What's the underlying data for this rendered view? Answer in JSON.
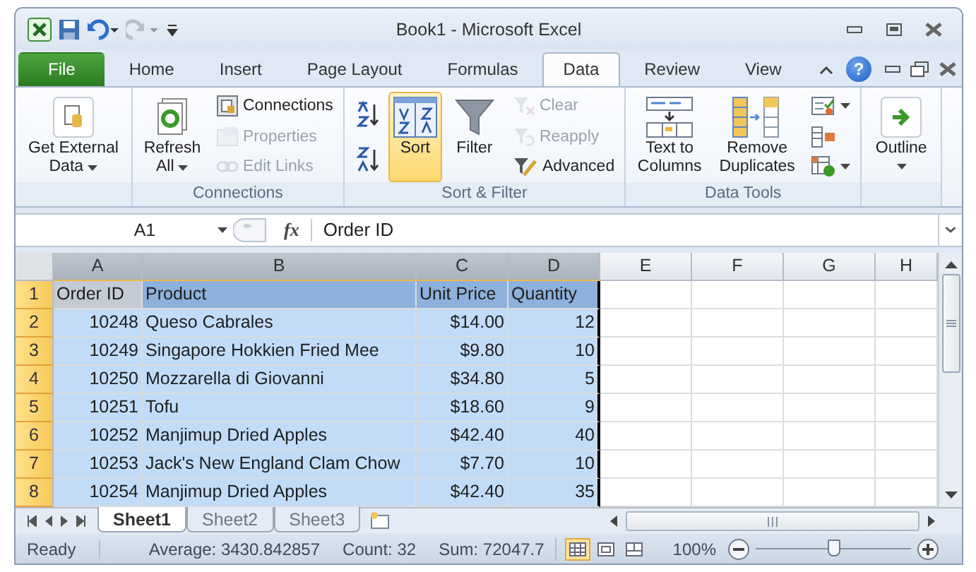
{
  "window": {
    "title": "Book1 - Microsoft Excel"
  },
  "ribbon_tabs": [
    {
      "label": "File",
      "kind": "file",
      "selected": false
    },
    {
      "label": "Home",
      "kind": "tab",
      "selected": false
    },
    {
      "label": "Insert",
      "kind": "tab",
      "selected": false
    },
    {
      "label": "Page Layout",
      "kind": "tab",
      "selected": false
    },
    {
      "label": "Formulas",
      "kind": "tab",
      "selected": false
    },
    {
      "label": "Data",
      "kind": "tab",
      "selected": true
    },
    {
      "label": "Review",
      "kind": "tab",
      "selected": false
    },
    {
      "label": "View",
      "kind": "tab",
      "selected": false
    }
  ],
  "help_button": "?",
  "ribbon_groups": [
    {
      "items": [
        {
          "kind": "large",
          "label": "Get External Data",
          "dropdown": true,
          "disabled": false,
          "highlighted": false
        }
      ]
    },
    {
      "label": "Connections",
      "items": [
        {
          "kind": "large",
          "label": "Refresh All",
          "dropdown": true,
          "disabled": false,
          "highlighted": false
        },
        {
          "kind": "stack",
          "items": [
            {
              "label": "Connections",
              "disabled": false
            },
            {
              "label": "Properties",
              "disabled": true
            },
            {
              "label": "Edit Links",
              "disabled": true
            }
          ]
        }
      ]
    },
    {
      "label": "Sort & Filter",
      "items": [
        {
          "kind": "stack",
          "items": [
            {
              "disabled": false
            },
            {
              "disabled": false
            }
          ]
        },
        {
          "kind": "large",
          "label": "Sort",
          "dropdown": false,
          "disabled": false,
          "highlighted": true
        },
        {
          "kind": "large",
          "label": "Filter",
          "dropdown": false,
          "disabled": false,
          "highlighted": false
        },
        {
          "kind": "stack",
          "items": [
            {
              "label": "Clear",
              "disabled": true
            },
            {
              "label": "Reapply",
              "disabled": true
            },
            {
              "label": "Advanced",
              "disabled": false
            }
          ]
        }
      ]
    },
    {
      "label": "Data Tools",
      "items": [
        {
          "kind": "large",
          "label": "Text to Columns",
          "dropdown": false,
          "disabled": false,
          "highlighted": false
        },
        {
          "kind": "large",
          "label": "Remove Duplicates",
          "dropdown": false,
          "disabled": false,
          "highlighted": false
        },
        {
          "kind": "stack",
          "items": [
            {
              "disabled": false,
              "dropdown": true
            },
            {
              "disabled": false,
              "dropdown": false
            },
            {
              "disabled": false,
              "dropdown": true
            }
          ]
        }
      ]
    },
    {
      "items": [
        {
          "kind": "large",
          "label": "Outline",
          "dropdown": true,
          "disabled": false,
          "highlighted": false
        }
      ]
    }
  ],
  "formula_bar": {
    "name_box": "A1",
    "function_label": "fx",
    "value": "Order ID"
  },
  "columns": [
    {
      "label": "A",
      "selected": true
    },
    {
      "label": "B",
      "selected": true
    },
    {
      "label": "C",
      "selected": true
    },
    {
      "label": "D",
      "selected": true
    },
    {
      "label": "E",
      "selected": false
    },
    {
      "label": "F",
      "selected": false
    },
    {
      "label": "G",
      "selected": false
    },
    {
      "label": "H",
      "selected": false
    }
  ],
  "rows": [
    {
      "number": "1",
      "kind": "header",
      "selected": true,
      "cells": [
        "Order ID",
        "Product",
        "Unit Price",
        "Quantity"
      ]
    },
    {
      "number": "2",
      "kind": "data",
      "selected": true,
      "cells": [
        "10248",
        "Queso Cabrales",
        "$14.00",
        "12"
      ]
    },
    {
      "number": "3",
      "kind": "data",
      "selected": true,
      "cells": [
        "10249",
        "Singapore Hokkien Fried Mee",
        "$9.80",
        "10"
      ]
    },
    {
      "number": "4",
      "kind": "data",
      "selected": true,
      "cells": [
        "10250",
        "Mozzarella di Giovanni",
        "$34.80",
        "5"
      ]
    },
    {
      "number": "5",
      "kind": "data",
      "selected": true,
      "cells": [
        "10251",
        "Tofu",
        "$18.60",
        "9"
      ]
    },
    {
      "number": "6",
      "kind": "data",
      "selected": true,
      "cells": [
        "10252",
        "Manjimup Dried Apples",
        "$42.40",
        "40"
      ]
    },
    {
      "number": "7",
      "kind": "data",
      "selected": true,
      "cells": [
        "10253",
        "Jack's New England Clam Chow",
        "$7.70",
        "10"
      ]
    },
    {
      "number": "8",
      "kind": "data",
      "selected": true,
      "cells": [
        "10254",
        "Manjimup Dried Apples",
        "$42.40",
        "35"
      ]
    }
  ],
  "sheet_tabs": [
    {
      "label": "Sheet1",
      "selected": true
    },
    {
      "label": "Sheet2",
      "selected": false
    },
    {
      "label": "Sheet3",
      "selected": false
    }
  ],
  "status_bar": {
    "mode": "Ready",
    "stats": [
      "Average: 3430.842857",
      "Count: 32",
      "Sum: 72047.7"
    ],
    "views": [
      {
        "selected": true
      },
      {
        "selected": false
      },
      {
        "selected": false
      }
    ],
    "zoom": "100%",
    "zoom_level": {
      "level": 0.5
    }
  }
}
